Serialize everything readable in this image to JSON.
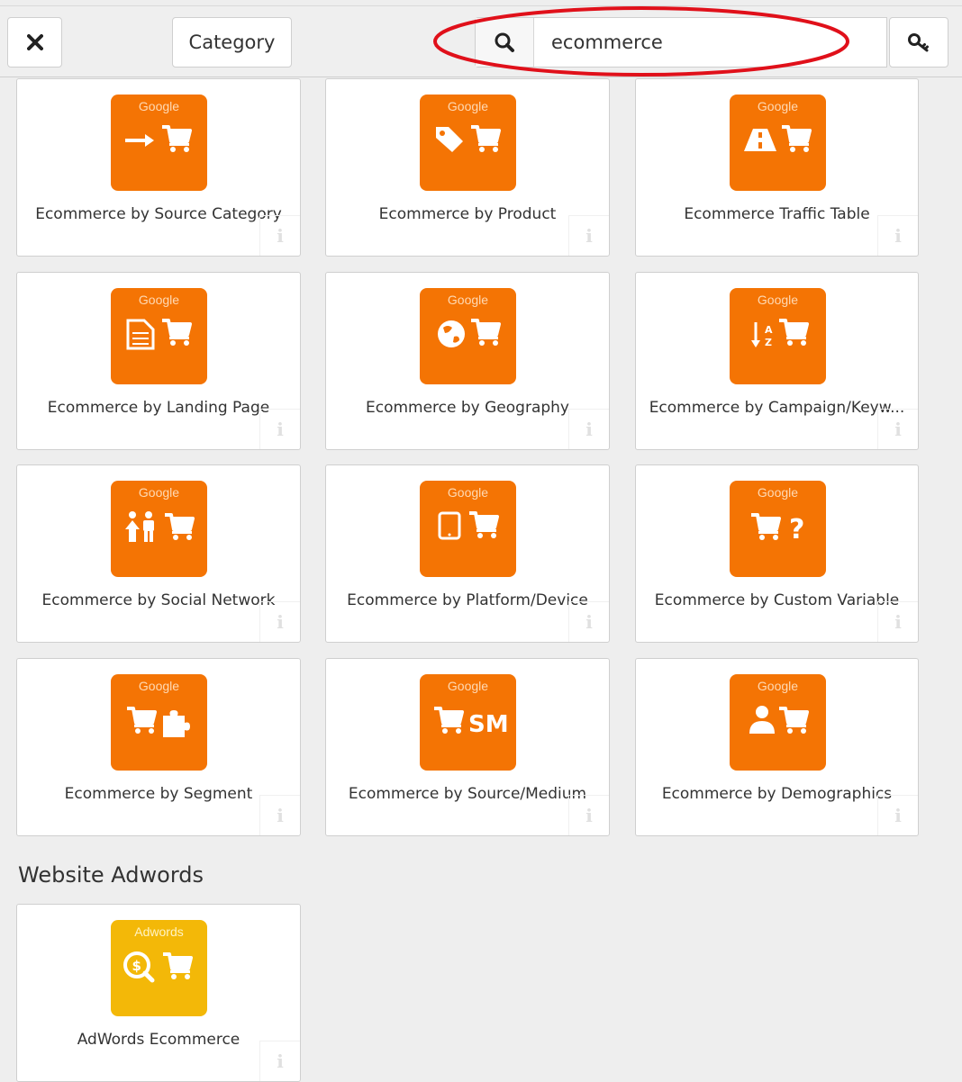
{
  "toolbar": {
    "category_label": "Category",
    "search_value": "ecommerce"
  },
  "colors": {
    "google_orange": "#f47404",
    "adwords_yellow": "#f3b808",
    "annotation_red": "#e0101a"
  },
  "cards": [
    {
      "badge": "Google",
      "title": "Ecommerce by Source Category",
      "icon": "arrow-cart-icon"
    },
    {
      "badge": "Google",
      "title": "Ecommerce by Product",
      "icon": "tag-cart-icon"
    },
    {
      "badge": "Google",
      "title": "Ecommerce Traffic Table",
      "icon": "road-cart-icon"
    },
    {
      "badge": "Google",
      "title": "Ecommerce by Landing Page",
      "icon": "document-cart-icon"
    },
    {
      "badge": "Google",
      "title": "Ecommerce by Geography",
      "icon": "globe-cart-icon"
    },
    {
      "badge": "Google",
      "title": "Ecommerce by Campaign/Keyw...",
      "icon": "sort-az-cart-icon"
    },
    {
      "badge": "Google",
      "title": "Ecommerce by Social Network",
      "icon": "people-cart-icon"
    },
    {
      "badge": "Google",
      "title": "Ecommerce by Platform/Device",
      "icon": "tablet-cart-icon"
    },
    {
      "badge": "Google",
      "title": "Ecommerce by Custom Variable",
      "icon": "cart-question-icon"
    },
    {
      "badge": "Google",
      "title": "Ecommerce by Segment",
      "icon": "cart-puzzle-icon"
    },
    {
      "badge": "Google",
      "title": "Ecommerce by Source/Medium",
      "icon": "cart-sm-icon",
      "icon_text": "SM"
    },
    {
      "badge": "Google",
      "title": "Ecommerce by Demographics",
      "icon": "person-cart-icon"
    }
  ],
  "sections": {
    "adwords_title": "Website Adwords"
  },
  "adwords_cards": [
    {
      "badge": "Adwords",
      "title": "AdWords Ecommerce",
      "icon": "search-dollar-cart-icon"
    }
  ]
}
